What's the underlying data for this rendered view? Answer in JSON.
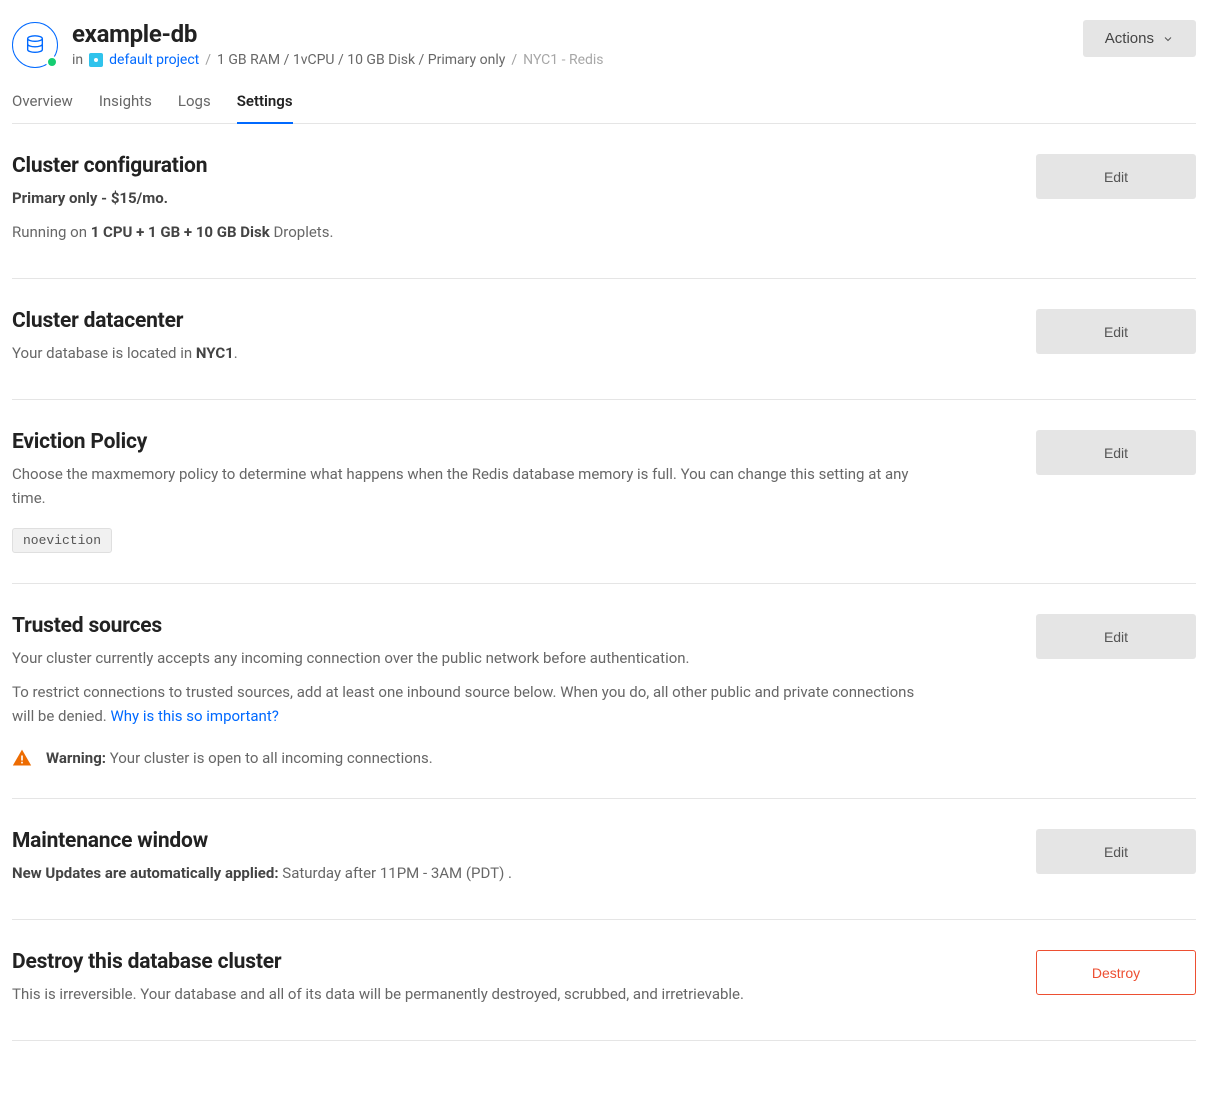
{
  "header": {
    "title": "example-db",
    "meta_in": "in",
    "project": "default project",
    "spec": "1 GB RAM / 1vCPU / 10 GB Disk / Primary only",
    "region_engine": "NYC1 - Redis",
    "actions_label": "Actions"
  },
  "tabs": [
    {
      "label": "Overview",
      "active": false
    },
    {
      "label": "Insights",
      "active": false
    },
    {
      "label": "Logs",
      "active": false
    },
    {
      "label": "Settings",
      "active": true
    }
  ],
  "sections": {
    "cluster_config": {
      "title": "Cluster configuration",
      "plan": "Primary only - $15/mo.",
      "running_prefix": "Running on ",
      "running_spec": "1 CPU + 1 GB + 10 GB Disk",
      "running_suffix": " Droplets.",
      "edit": "Edit"
    },
    "datacenter": {
      "title": "Cluster datacenter",
      "desc_prefix": "Your database is located in ",
      "region": "NYC1",
      "desc_suffix": ".",
      "edit": "Edit"
    },
    "eviction": {
      "title": "Eviction Policy",
      "desc": "Choose the maxmemory policy to determine what happens when the Redis database memory is full. You can change this setting at any time.",
      "policy": "noeviction",
      "edit": "Edit"
    },
    "trusted": {
      "title": "Trusted sources",
      "desc1": "Your cluster currently accepts any incoming connection over the public network before authentication.",
      "desc2_prefix": "To restrict connections to trusted sources, add at least one inbound source below. When you do, all other public and private connections will be denied. ",
      "desc2_link": "Why is this so important?",
      "warn_label": "Warning:",
      "warn_text": " Your cluster is open to all incoming connections.",
      "edit": "Edit"
    },
    "maintenance": {
      "title": "Maintenance window",
      "label": "New Updates are automatically applied:",
      "value": " Saturday after 11PM - 3AM (PDT) .",
      "edit": "Edit"
    },
    "destroy": {
      "title": "Destroy this database cluster",
      "desc": "This is irreversible. Your database and all of its data will be permanently destroyed, scrubbed, and irretrievable.",
      "btn": "Destroy"
    }
  }
}
